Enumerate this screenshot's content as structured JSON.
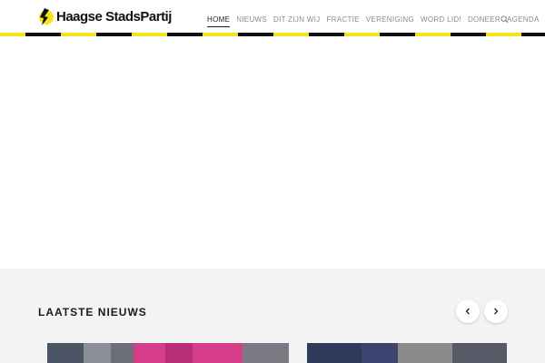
{
  "brand": {
    "name": "Haagse StadsPartij",
    "accent": "#f5e31a"
  },
  "nav": {
    "items": [
      {
        "label": "HOME",
        "active": true
      },
      {
        "label": "NIEUWS",
        "active": false
      },
      {
        "label": "DIT ZIJN WIJ",
        "active": false
      },
      {
        "label": "FRACTIE",
        "active": false
      },
      {
        "label": "VERENIGING",
        "active": false
      },
      {
        "label": "WORD LID!",
        "active": false
      },
      {
        "label": "DONEER",
        "active": false
      },
      {
        "label": "AGENDA",
        "active": false
      }
    ],
    "search_icon": "search-icon"
  },
  "news": {
    "title": "LAATSTE NIEUWS",
    "prev_icon": "chevron-left-icon",
    "next_icon": "chevron-right-icon"
  }
}
